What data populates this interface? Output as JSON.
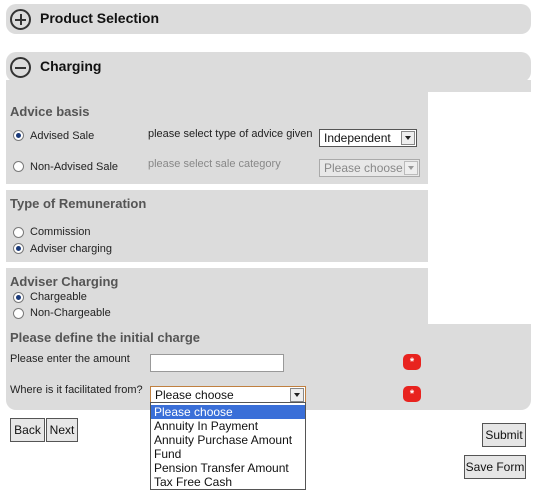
{
  "product_selection": {
    "title": "Product Selection",
    "icon": "plus-circle-icon"
  },
  "charging": {
    "title": "Charging",
    "icon": "minus-circle-icon"
  },
  "advice_basis": {
    "heading": "Advice basis",
    "advised_sale": {
      "label": "Advised Sale",
      "checked": true
    },
    "advice_type_label": "please select type of advice given",
    "advice_type_value": "Independent",
    "non_advised_sale": {
      "label": "Non-Advised Sale",
      "checked": false
    },
    "sale_category_label": "please select sale category",
    "sale_category_value": "Please choose"
  },
  "remuneration": {
    "heading": "Type of Remuneration",
    "options": [
      {
        "label": "Commission",
        "checked": false
      },
      {
        "label": "Adviser charging",
        "checked": true
      }
    ]
  },
  "adviser_charging": {
    "heading": "Adviser Charging",
    "options": [
      {
        "label": "Chargeable",
        "checked": true
      },
      {
        "label": "Non-Chargeable",
        "checked": false
      }
    ]
  },
  "initial_charge": {
    "heading": "Please define the initial charge",
    "amount_label": "Please enter the amount",
    "amount_value": "",
    "facilitated_label": "Where is it facilitated from?",
    "facilitated_value": "Please choose",
    "required_marker": "*",
    "dropdown_options": [
      "Please choose",
      "Annuity In Payment",
      "Annuity Purchase Amount",
      "Fund",
      "Pension Transfer Amount",
      "Tax Free Cash"
    ],
    "dropdown_selected_index": 0
  },
  "buttons": {
    "back": "Back",
    "next": "Next",
    "submit": "Submit",
    "save_form": "Save Form"
  },
  "colors": {
    "panel_bg": "#dcdcdc",
    "required_red": "#e8231f",
    "dropdown_highlight": "#3a6fd8"
  }
}
